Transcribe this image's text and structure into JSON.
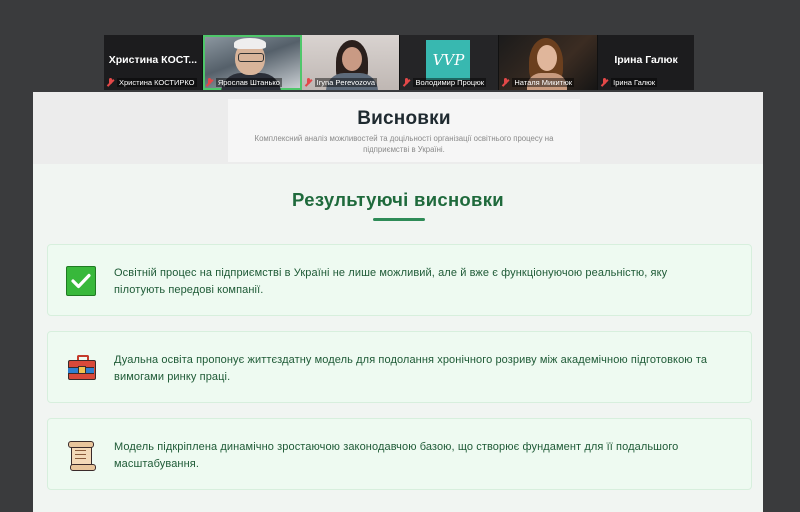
{
  "participants": [
    {
      "big_name": "Христина  КОСТ...",
      "caption": "Христина КОСТИРКО",
      "muted": true,
      "type": "name"
    },
    {
      "big_name": "",
      "caption": "Ярослав Штанько",
      "muted": true,
      "type": "video-man",
      "active": true
    },
    {
      "big_name": "",
      "caption": "Iryna Perevozova",
      "muted": true,
      "type": "video-woman"
    },
    {
      "big_name": "",
      "caption": "Володимир Процюк",
      "muted": true,
      "type": "logo",
      "logo_text": "VVP"
    },
    {
      "big_name": "",
      "caption": "Наталя Микитюк",
      "muted": true,
      "type": "video-n"
    },
    {
      "big_name": "Ірина Галюк",
      "caption": "Ірина Галюк",
      "muted": true,
      "type": "name"
    }
  ],
  "slide": {
    "title": "Висновки",
    "subtitle": "Комплексний аналіз можливостей та доцільності організації освітнього процесу на підприємстві в Україні.",
    "section_title": "Результуючі висновки",
    "cards": [
      {
        "icon": "check-icon",
        "text": "Освітній процес на підприємстві в Україні не лише можливий, але й вже є функціонуючою реальністю, яку пілотують передові компанії."
      },
      {
        "icon": "briefcase-icon",
        "text": "Дуальна освіта пропонує життєздатну модель для подолання хронічного розриву між академічною підготовкою та вимогами ринку праці."
      },
      {
        "icon": "scroll-icon",
        "text": "Модель підкріплена динамічно зростаючою законодавчою базою, що створює фундамент для її подальшого масштабування."
      }
    ]
  },
  "colors": {
    "accent": "#1f6a3c",
    "card_bg": "#eefaf1",
    "muted_mic": "#e34848",
    "active_speaker": "#4ec76a"
  }
}
